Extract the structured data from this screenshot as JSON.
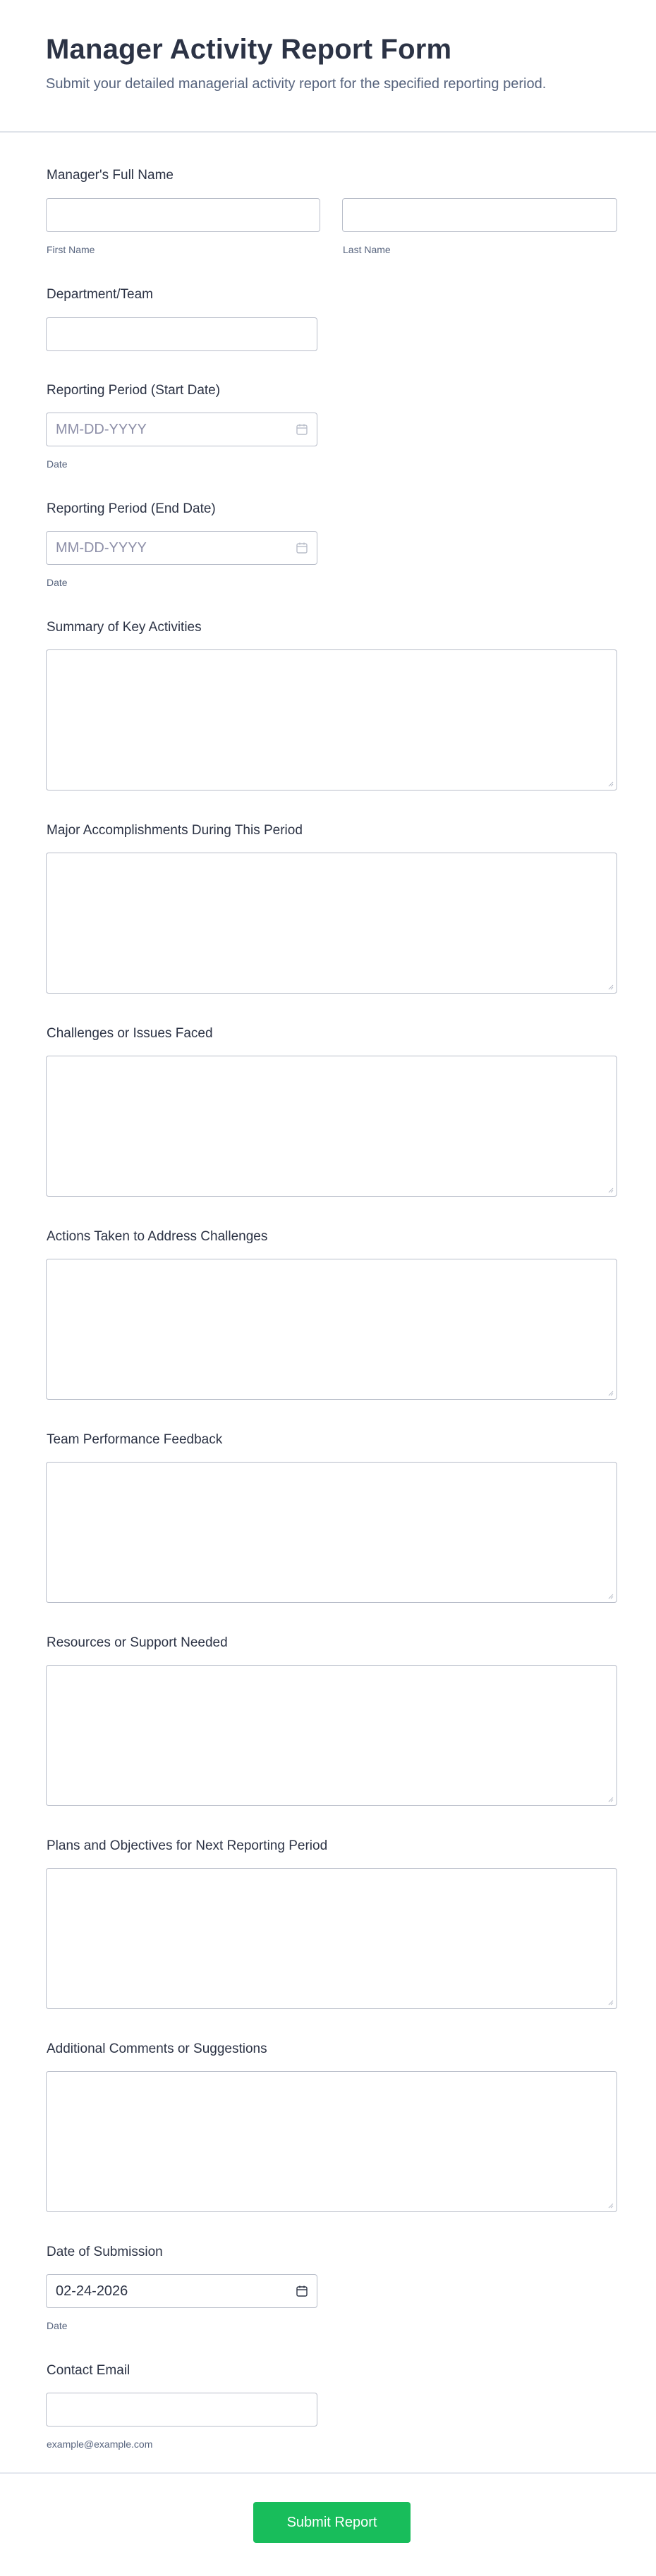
{
  "header": {
    "title": "Manager Activity Report Form",
    "subtitle": "Submit your detailed managerial activity report for the specified reporting period."
  },
  "fields": {
    "full_name": {
      "label": "Manager's Full Name",
      "first": {
        "value": "",
        "sublabel": "First Name"
      },
      "last": {
        "value": "",
        "sublabel": "Last Name"
      }
    },
    "department": {
      "label": "Department/Team",
      "value": ""
    },
    "start_date": {
      "label": "Reporting Period (Start Date)",
      "placeholder": "MM-DD-YYYY",
      "sublabel": "Date"
    },
    "end_date": {
      "label": "Reporting Period (End Date)",
      "placeholder": "MM-DD-YYYY",
      "sublabel": "Date"
    },
    "summary": {
      "label": "Summary of Key Activities"
    },
    "accomplishments": {
      "label": "Major Accomplishments During This Period"
    },
    "challenges": {
      "label": "Challenges or Issues Faced"
    },
    "actions": {
      "label": "Actions Taken to Address Challenges"
    },
    "team_feedback": {
      "label": "Team Performance Feedback"
    },
    "resources": {
      "label": "Resources or Support Needed"
    },
    "plans": {
      "label": "Plans and Objectives for Next Reporting Period"
    },
    "comments": {
      "label": "Additional Comments or Suggestions"
    },
    "submission_date": {
      "label": "Date of Submission",
      "value": "02-24-2026",
      "sublabel": "Date"
    },
    "email": {
      "label": "Contact Email",
      "value": "",
      "sublabel": "example@example.com"
    }
  },
  "submit": {
    "label": "Submit Report"
  },
  "colors": {
    "accent": "#18bd5b",
    "text": "#2c3345",
    "muted": "#57647e",
    "border": "#b8bdc9"
  },
  "icons": [
    "calendar-icon",
    "resize-grip-icon"
  ]
}
